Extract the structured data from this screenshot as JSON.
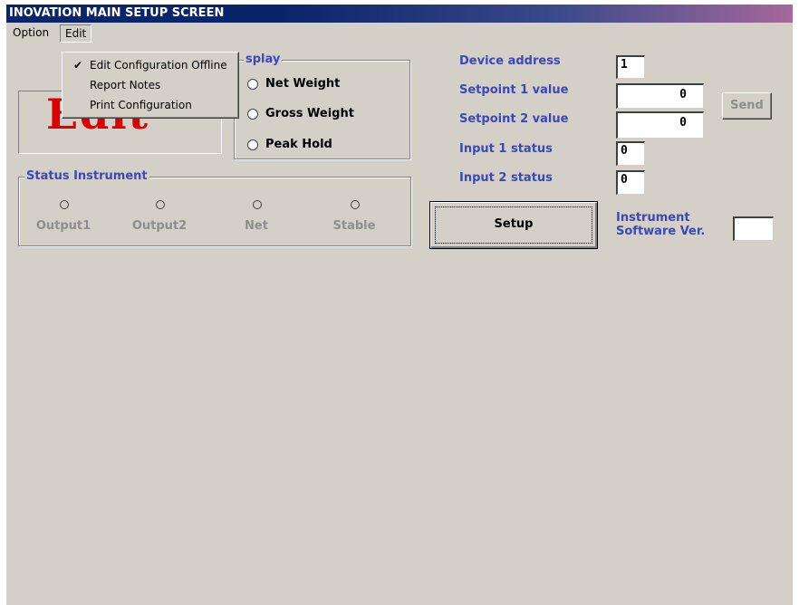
{
  "window": {
    "title": "INOVATION MAIN SETUP SCREEN"
  },
  "menubar": {
    "items": [
      {
        "label": "Option"
      },
      {
        "label": "Edit"
      }
    ]
  },
  "edit_menu": {
    "items": [
      {
        "label": "Edit Configuration Offline",
        "checked": true
      },
      {
        "label": "Report Notes",
        "checked": false
      },
      {
        "label": "Print Configuration",
        "checked": false
      }
    ],
    "check_glyph": "✔"
  },
  "lcd_display": {
    "text": "Edit",
    "color": "#dd0000"
  },
  "display_group": {
    "title": "Display",
    "visible_title": "splay",
    "options": [
      {
        "label": "Net Weight"
      },
      {
        "label": "Gross Weight"
      },
      {
        "label": "Peak Hold"
      }
    ]
  },
  "status_group": {
    "title": "Status Instrument",
    "indicators": [
      {
        "label": "Output1"
      },
      {
        "label": "Output2"
      },
      {
        "label": "Net"
      },
      {
        "label": "Stable"
      }
    ]
  },
  "device": {
    "address_label": "Device address",
    "address_value": "1",
    "setpoint1_label": "Setpoint 1 value",
    "setpoint1_value": "0",
    "setpoint2_label": "Setpoint 2 value",
    "setpoint2_value": "0",
    "input1_label": "Input 1 status",
    "input1_value": "0",
    "input2_label": "Input 2 status",
    "input2_value": "0",
    "sw_label_line1": "Instrument",
    "sw_label_line2": "Software Ver.",
    "sw_value": ""
  },
  "buttons": {
    "setup": "Setup",
    "send": "Send"
  },
  "colors": {
    "label_blue": "#3a48b8",
    "disabled_gray": "#8e8e8e",
    "face": "#d4d0c8"
  }
}
